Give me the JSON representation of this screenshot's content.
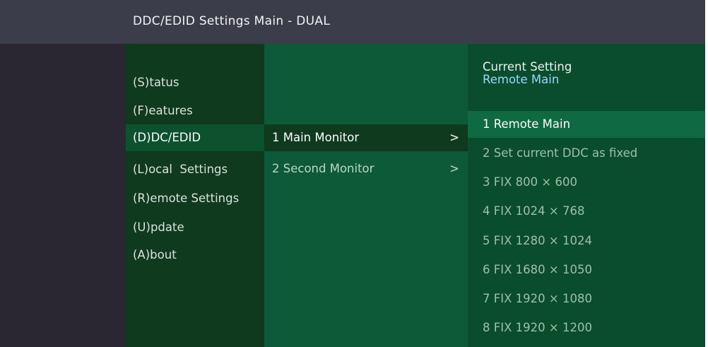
{
  "window": {
    "title": "DDC/EDID Settings Main - DUAL"
  },
  "menu": {
    "items": [
      {
        "label": "(S)tatus"
      },
      {
        "label": "(F)eatures"
      },
      {
        "label": "(D)DC/EDID"
      },
      {
        "label": "(L)ocal  Settings"
      },
      {
        "label": "(R)emote Settings"
      },
      {
        "label": "(U)pdate"
      },
      {
        "label": "(A)bout"
      }
    ],
    "selected_index": 2
  },
  "submenu": {
    "items": [
      {
        "label": "1 Main Monitor",
        "arrow": ">"
      },
      {
        "label": "2 Second Monitor",
        "arrow": ">"
      }
    ],
    "selected_index": 0
  },
  "options": {
    "current_label": "Current Setting",
    "current_value": "Remote Main",
    "items": [
      {
        "label": "1 Remote Main"
      },
      {
        "label": "2 Set current DDC as fixed"
      },
      {
        "label": "3 FIX 800 × 600"
      },
      {
        "label": "4 FIX 1024 × 768"
      },
      {
        "label": "5 FIX 1280 × 1024"
      },
      {
        "label": "6 FIX 1680 × 1050"
      },
      {
        "label": "7 FIX 1920 × 1080"
      },
      {
        "label": "8 FIX 1920 × 1200"
      }
    ],
    "selected_index": 0
  },
  "colors": {
    "titlebar": "#3b3e4a",
    "menu_bg": "#0f3a1e",
    "submenu_bg": "#0d5a38",
    "options_bg": "#0a4d2c",
    "highlight_blue": "#9ad6ff"
  }
}
